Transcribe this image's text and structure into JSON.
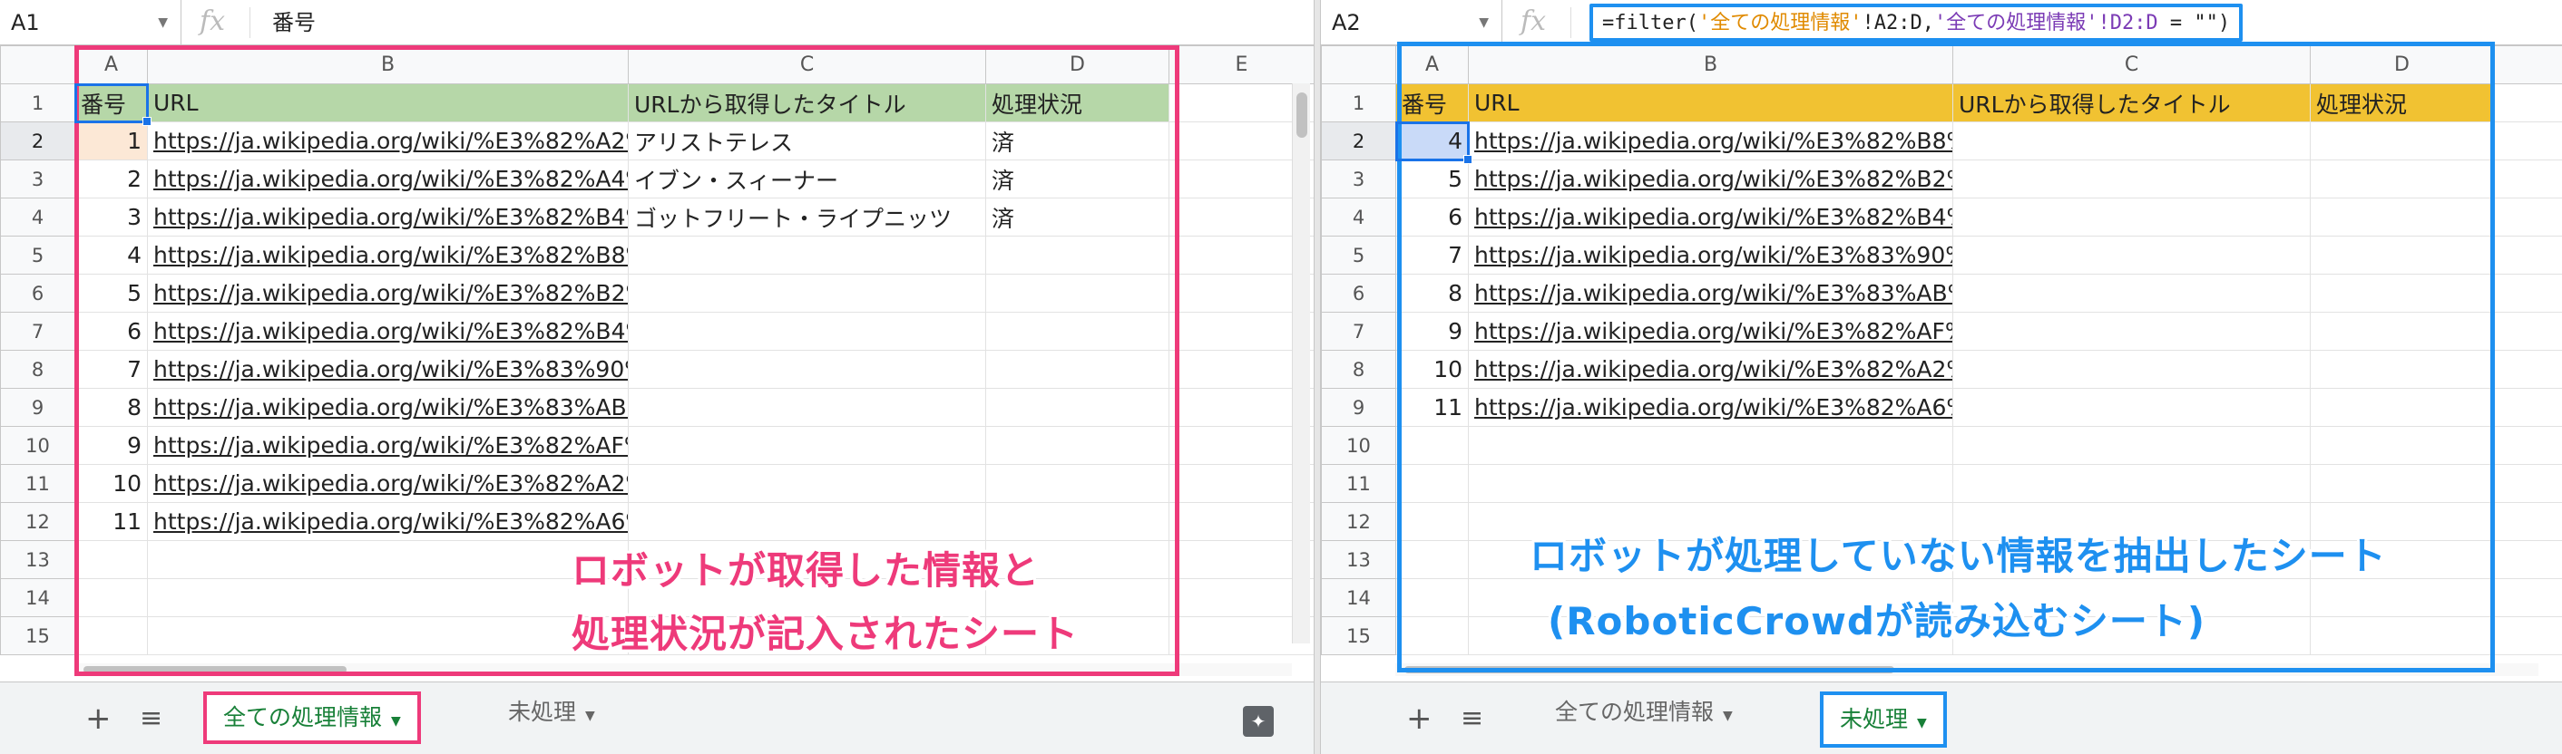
{
  "left": {
    "namebox": "A1",
    "formula": "番号",
    "columns": [
      "A",
      "B",
      "C",
      "D",
      "E"
    ],
    "header": [
      "番号",
      "URL",
      "URLから取得したタイトル",
      "処理状況"
    ],
    "rows": [
      {
        "r": "2",
        "a": "1",
        "b": "https://ja.wikipedia.org/wiki/%E3%82%A2%E",
        "c": "アリストテレス",
        "d": "済"
      },
      {
        "r": "3",
        "a": "2",
        "b": "https://ja.wikipedia.org/wiki/%E3%82%A4%E",
        "c": "イブン・スィーナー",
        "d": "済"
      },
      {
        "r": "4",
        "a": "3",
        "b": "https://ja.wikipedia.org/wiki/%E3%82%B4%E",
        "c": "ゴットフリート・ライプニッツ",
        "d": "済"
      },
      {
        "r": "5",
        "a": "4",
        "b": "https://ja.wikipedia.org/wiki/%E3%82%B8%E",
        "c": "",
        "d": ""
      },
      {
        "r": "6",
        "a": "5",
        "b": "https://ja.wikipedia.org/wiki/%E3%82%B2%E",
        "c": "",
        "d": ""
      },
      {
        "r": "7",
        "a": "6",
        "b": "https://ja.wikipedia.org/wiki/%E3%82%B4%E",
        "c": "",
        "d": ""
      },
      {
        "r": "8",
        "a": "7",
        "b": "https://ja.wikipedia.org/wiki/%E3%83%90%E",
        "c": "",
        "d": ""
      },
      {
        "r": "9",
        "a": "8",
        "b": "https://ja.wikipedia.org/wiki/%E3%83%AB%E",
        "c": "",
        "d": ""
      },
      {
        "r": "10",
        "a": "9",
        "b": "https://ja.wikipedia.org/wiki/%E3%82%AF%E",
        "c": "",
        "d": ""
      },
      {
        "r": "11",
        "a": "10",
        "b": "https://ja.wikipedia.org/wiki/%E3%82%A2%E",
        "c": "",
        "d": ""
      },
      {
        "r": "12",
        "a": "11",
        "b": "https://ja.wikipedia.org/wiki/%E3%82%A6%E",
        "c": "",
        "d": ""
      },
      {
        "r": "13",
        "a": "",
        "b": "",
        "c": "",
        "d": ""
      },
      {
        "r": "14",
        "a": "",
        "b": "",
        "c": "",
        "d": ""
      },
      {
        "r": "15",
        "a": "",
        "b": "",
        "c": "",
        "d": ""
      }
    ],
    "tabs": [
      "全ての処理情報",
      "未処理"
    ],
    "note_line1": "ロボットが取得した情報と",
    "note_line2": "処理状況が記入されたシート"
  },
  "right": {
    "namebox": "A2",
    "formula_parts": [
      "=filter(",
      "'全ての処理情報'",
      "!A2:D",
      ",",
      "'全ての処理情報'",
      "!D2:D",
      " = \"\")"
    ],
    "columns": [
      "A",
      "B",
      "C",
      "D"
    ],
    "header": [
      "番号",
      "URL",
      "URLから取得したタイトル",
      "処理状況"
    ],
    "rows": [
      {
        "r": "2",
        "a": "4",
        "b": "https://ja.wikipedia.org/wiki/%E3%82%B8%E"
      },
      {
        "r": "3",
        "a": "5",
        "b": "https://ja.wikipedia.org/wiki/%E3%82%B2%E"
      },
      {
        "r": "4",
        "a": "6",
        "b": "https://ja.wikipedia.org/wiki/%E3%82%B4%E"
      },
      {
        "r": "5",
        "a": "7",
        "b": "https://ja.wikipedia.org/wiki/%E3%83%90%E"
      },
      {
        "r": "6",
        "a": "8",
        "b": "https://ja.wikipedia.org/wiki/%E3%83%AB%E"
      },
      {
        "r": "7",
        "a": "9",
        "b": "https://ja.wikipedia.org/wiki/%E3%82%AF%E"
      },
      {
        "r": "8",
        "a": "10",
        "b": "https://ja.wikipedia.org/wiki/%E3%82%A2%E"
      },
      {
        "r": "9",
        "a": "11",
        "b": "https://ja.wikipedia.org/wiki/%E3%82%A6%E"
      },
      {
        "r": "10",
        "a": "",
        "b": ""
      },
      {
        "r": "11",
        "a": "",
        "b": ""
      },
      {
        "r": "12",
        "a": "",
        "b": ""
      },
      {
        "r": "13",
        "a": "",
        "b": ""
      },
      {
        "r": "14",
        "a": "",
        "b": ""
      },
      {
        "r": "15",
        "a": "",
        "b": ""
      }
    ],
    "tabs": [
      "全ての処理情報",
      "未処理"
    ],
    "note_line1": "ロボットが処理していない情報を抽出したシート",
    "note_line2": "(RoboticCrowdが読み込むシート)"
  },
  "icons": {
    "fx": "fx",
    "add": "+",
    "list": "≡",
    "explore": "explore-icon"
  },
  "colors": {
    "pink": "#ee3a7a",
    "blue": "#1e90f0",
    "greenHeader": "#b6d7a8",
    "yellowHeader": "#f1c232"
  }
}
